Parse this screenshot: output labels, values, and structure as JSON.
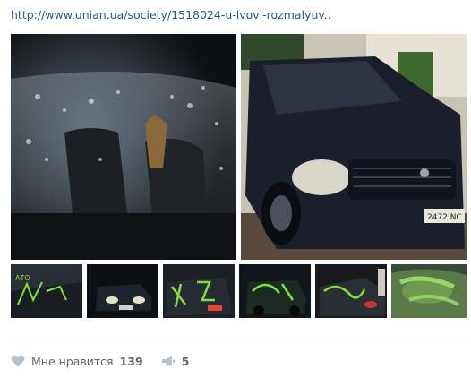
{
  "post": {
    "link_text": "http://www.unian.ua/society/1518024-u-lvovi-rozmalyuv..",
    "photos": [
      {
        "subject": "car-interior-through-windshield"
      },
      {
        "subject": "dark-suv-front-view"
      }
    ],
    "thumbnails": [
      {
        "subject": "car-with-green-graffiti"
      },
      {
        "subject": "dark-car-at-night"
      },
      {
        "subject": "car-with-green-graffiti"
      },
      {
        "subject": "car-with-green-graffiti"
      },
      {
        "subject": "car-with-green-graffiti"
      },
      {
        "subject": "green-paint-on-windshield"
      }
    ]
  },
  "actions": {
    "like": {
      "label": "Мне нравится",
      "count": "139",
      "icon": "heart-icon"
    },
    "share": {
      "count": "5",
      "icon": "megaphone-icon"
    }
  },
  "colors": {
    "link": "#2a5885",
    "graffiti": "#7ee03a",
    "divider": "#e7e8ec",
    "action_text": "#656565"
  }
}
